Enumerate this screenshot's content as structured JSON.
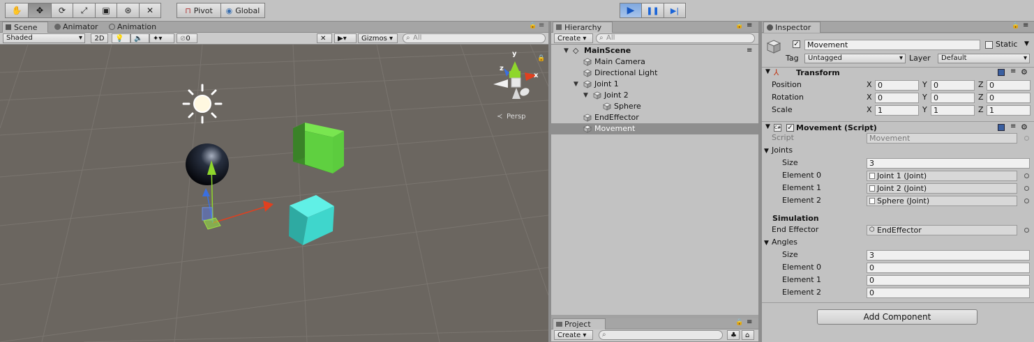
{
  "toolbar": {
    "tools": [
      "hand-tool",
      "move-tool",
      "rotate-tool",
      "scale-tool",
      "rect-tool",
      "transform-tool",
      "custom-tool"
    ],
    "pivot_label": "Pivot",
    "global_label": "Global",
    "play_glyph": "▶",
    "pause_glyph": "❚❚",
    "step_glyph": "▶|"
  },
  "scene_tabs": {
    "scene": "Scene",
    "animator": "Animator",
    "animation": "Animation"
  },
  "scene_bar": {
    "shading": "Shaded",
    "mode_2d": "2D",
    "hidden_count": "0",
    "gizmos": "Gizmos",
    "search_placeholder": "All",
    "persp_label": "Persp"
  },
  "gizmo_axes": {
    "x": "x",
    "y": "y",
    "z": "z"
  },
  "hierarchy": {
    "tab": "Hierarchy",
    "create": "Create",
    "search_placeholder": "All",
    "scene_name": "MainScene",
    "items": [
      {
        "label": "Main Camera",
        "indent": 1,
        "arrow": ""
      },
      {
        "label": "Directional Light",
        "indent": 1,
        "arrow": ""
      },
      {
        "label": "Joint 1",
        "indent": 1,
        "arrow": "▼"
      },
      {
        "label": "Joint 2",
        "indent": 2,
        "arrow": "▼"
      },
      {
        "label": "Sphere",
        "indent": 3,
        "arrow": ""
      },
      {
        "label": "EndEffector",
        "indent": 1,
        "arrow": ""
      },
      {
        "label": "Movement",
        "indent": 1,
        "arrow": "",
        "selected": true
      }
    ]
  },
  "project": {
    "tab": "Project",
    "create": "Create"
  },
  "inspector": {
    "tab": "Inspector",
    "object_name": "Movement",
    "static_label": "Static",
    "tag_label": "Tag",
    "tag_value": "Untagged",
    "layer_label": "Layer",
    "layer_value": "Default",
    "transform": {
      "title": "Transform",
      "rows": [
        {
          "label": "Position",
          "x": "0",
          "y": "0",
          "z": "0"
        },
        {
          "label": "Rotation",
          "x": "0",
          "y": "0",
          "z": "0"
        },
        {
          "label": "Scale",
          "x": "1",
          "y": "1",
          "z": "1"
        }
      ]
    },
    "movement": {
      "title": "Movement (Script)",
      "script_label": "Script",
      "script_value": "Movement",
      "joints_label": "Joints",
      "size_label": "Size",
      "joints_size": "3",
      "joints": [
        {
          "label": "Element 0",
          "value": "Joint 1 (Joint)"
        },
        {
          "label": "Element 1",
          "value": "Joint 2 (Joint)"
        },
        {
          "label": "Element 2",
          "value": "Sphere (Joint)"
        }
      ],
      "simulation_label": "Simulation",
      "end_effector_label": "End Effector",
      "end_effector_value": "EndEffector",
      "angles_label": "Angles",
      "angles_size": "3",
      "angles": [
        {
          "label": "Element 0",
          "value": "0"
        },
        {
          "label": "Element 1",
          "value": "0"
        },
        {
          "label": "Element 2",
          "value": "0"
        }
      ]
    },
    "add_component": "Add Component"
  },
  "colors": {
    "scene_bg": "#6b6660",
    "green_cube": "#5fd040",
    "cyan_cube": "#3fd6cc",
    "x_axis": "#e0401f",
    "y_axis": "#8fd72c",
    "z_axis": "#3a6fe0",
    "selection": "#8e8e8e"
  }
}
